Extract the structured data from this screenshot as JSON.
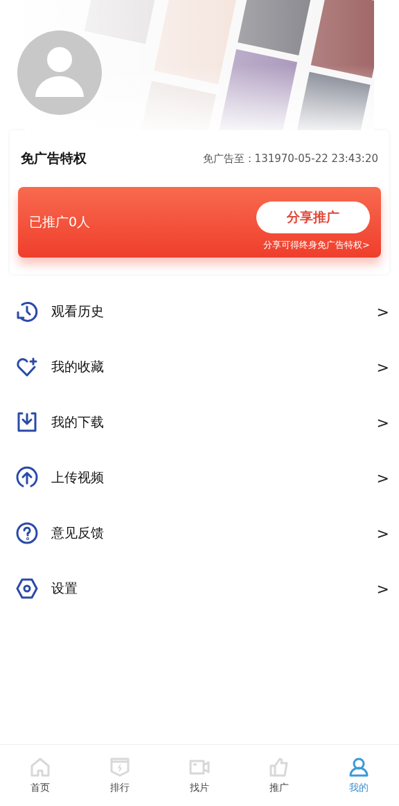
{
  "privilege_card": {
    "title": "免广告特权",
    "expiry": "免广告至：131970-05-22 23:43:20",
    "promo": {
      "count_text": "已推广0人",
      "share_button": "分享推广",
      "hint_link": "分享可得终身免广告特权>"
    }
  },
  "menu": [
    {
      "kind": "history",
      "label": "观看历史",
      "chevron": ">"
    },
    {
      "kind": "favorite",
      "label": "我的收藏",
      "chevron": ">"
    },
    {
      "kind": "download",
      "label": "我的下载",
      "chevron": ">"
    },
    {
      "kind": "upload",
      "label": "上传视频",
      "chevron": ">"
    },
    {
      "kind": "feedback",
      "label": "意见反馈",
      "chevron": ">"
    },
    {
      "kind": "settings",
      "label": "设置",
      "chevron": ">"
    }
  ],
  "tab_bar": [
    {
      "kind": "home",
      "label": "首页",
      "selected": false
    },
    {
      "kind": "ranking",
      "label": "排行",
      "selected": false
    },
    {
      "kind": "video",
      "label": "找片",
      "selected": false
    },
    {
      "kind": "promote",
      "label": "推广",
      "selected": false
    },
    {
      "kind": "profile",
      "label": "我的",
      "selected": true
    }
  ]
}
